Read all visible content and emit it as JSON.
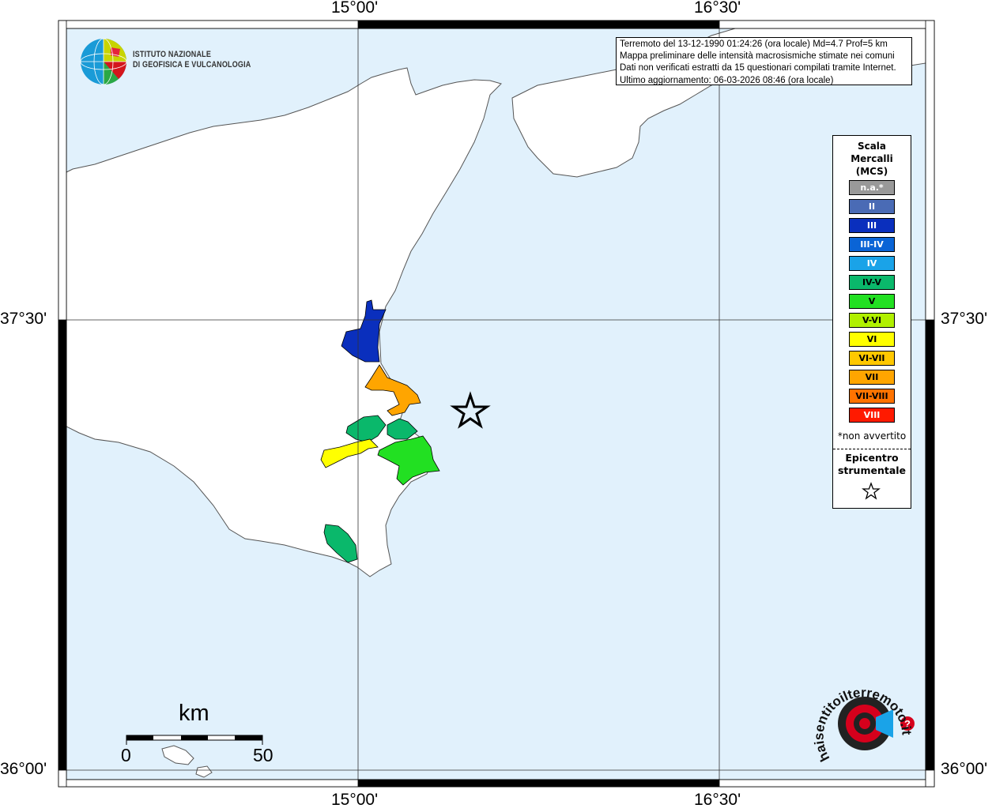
{
  "map": {
    "axis_labels": {
      "top": [
        "15°00'",
        "16°30'"
      ],
      "bottom": [
        "15°00'",
        "16°30'"
      ],
      "left": [
        "37°30'",
        "36°00'"
      ],
      "right": [
        "37°30'",
        "36°00'"
      ]
    },
    "colors": {
      "sea": "#e1f1fc",
      "land": "#ffffff",
      "coast": "#555555"
    }
  },
  "info_box": {
    "line1": "Terremoto del 13-12-1990 01:24:26 (ora locale) Md=4.7 Prof=5 km",
    "line2": "Mappa preliminare delle intensità macrosismiche stimate nei comuni",
    "line3": "Dati non verificati estratti da 15 questionari compilati tramite Internet.",
    "line4": "Ultimo aggiornamento: 06-03-2026 08:46 (ora locale)"
  },
  "logo": {
    "line1": "ISTITUTO NAZIONALE",
    "line2": "DI GEOFISICA E VULCANOLOGIA",
    "icon": "ingv-globe-icon"
  },
  "legend": {
    "title": [
      "Scala",
      "Mercalli",
      "(MCS)"
    ],
    "items": [
      {
        "label": "n.a.*",
        "color": "#999999",
        "text": "#ffffff"
      },
      {
        "label": "II",
        "color": "#4a6bb5",
        "text": "#ffffff"
      },
      {
        "label": "III",
        "color": "#0a2fbd",
        "text": "#ffffff"
      },
      {
        "label": "III-IV",
        "color": "#0a64d6",
        "text": "#ffffff"
      },
      {
        "label": "IV",
        "color": "#1aa3e8",
        "text": "#ffffff"
      },
      {
        "label": "IV-V",
        "color": "#0ab86b",
        "text": "#000000"
      },
      {
        "label": "V",
        "color": "#22e022",
        "text": "#000000"
      },
      {
        "label": "V-VI",
        "color": "#b0f000",
        "text": "#000000"
      },
      {
        "label": "VI",
        "color": "#ffff00",
        "text": "#000000"
      },
      {
        "label": "VI-VII",
        "color": "#ffc800",
        "text": "#000000"
      },
      {
        "label": "VII",
        "color": "#ffa500",
        "text": "#000000"
      },
      {
        "label": "VII-VIII",
        "color": "#ff7300",
        "text": "#000000"
      },
      {
        "label": "VIII",
        "color": "#ff1a00",
        "text": "#ffffff"
      }
    ],
    "note": "*non avvertito",
    "epicenter_title": [
      "Epicentro",
      "strumentale"
    ]
  },
  "scale_bar": {
    "unit": "km",
    "min_label": "0",
    "max_label": "50"
  },
  "hsit_logo": {
    "text": "haisentitoilterremoto.it",
    "icon": "hsit-megaphone-icon"
  }
}
